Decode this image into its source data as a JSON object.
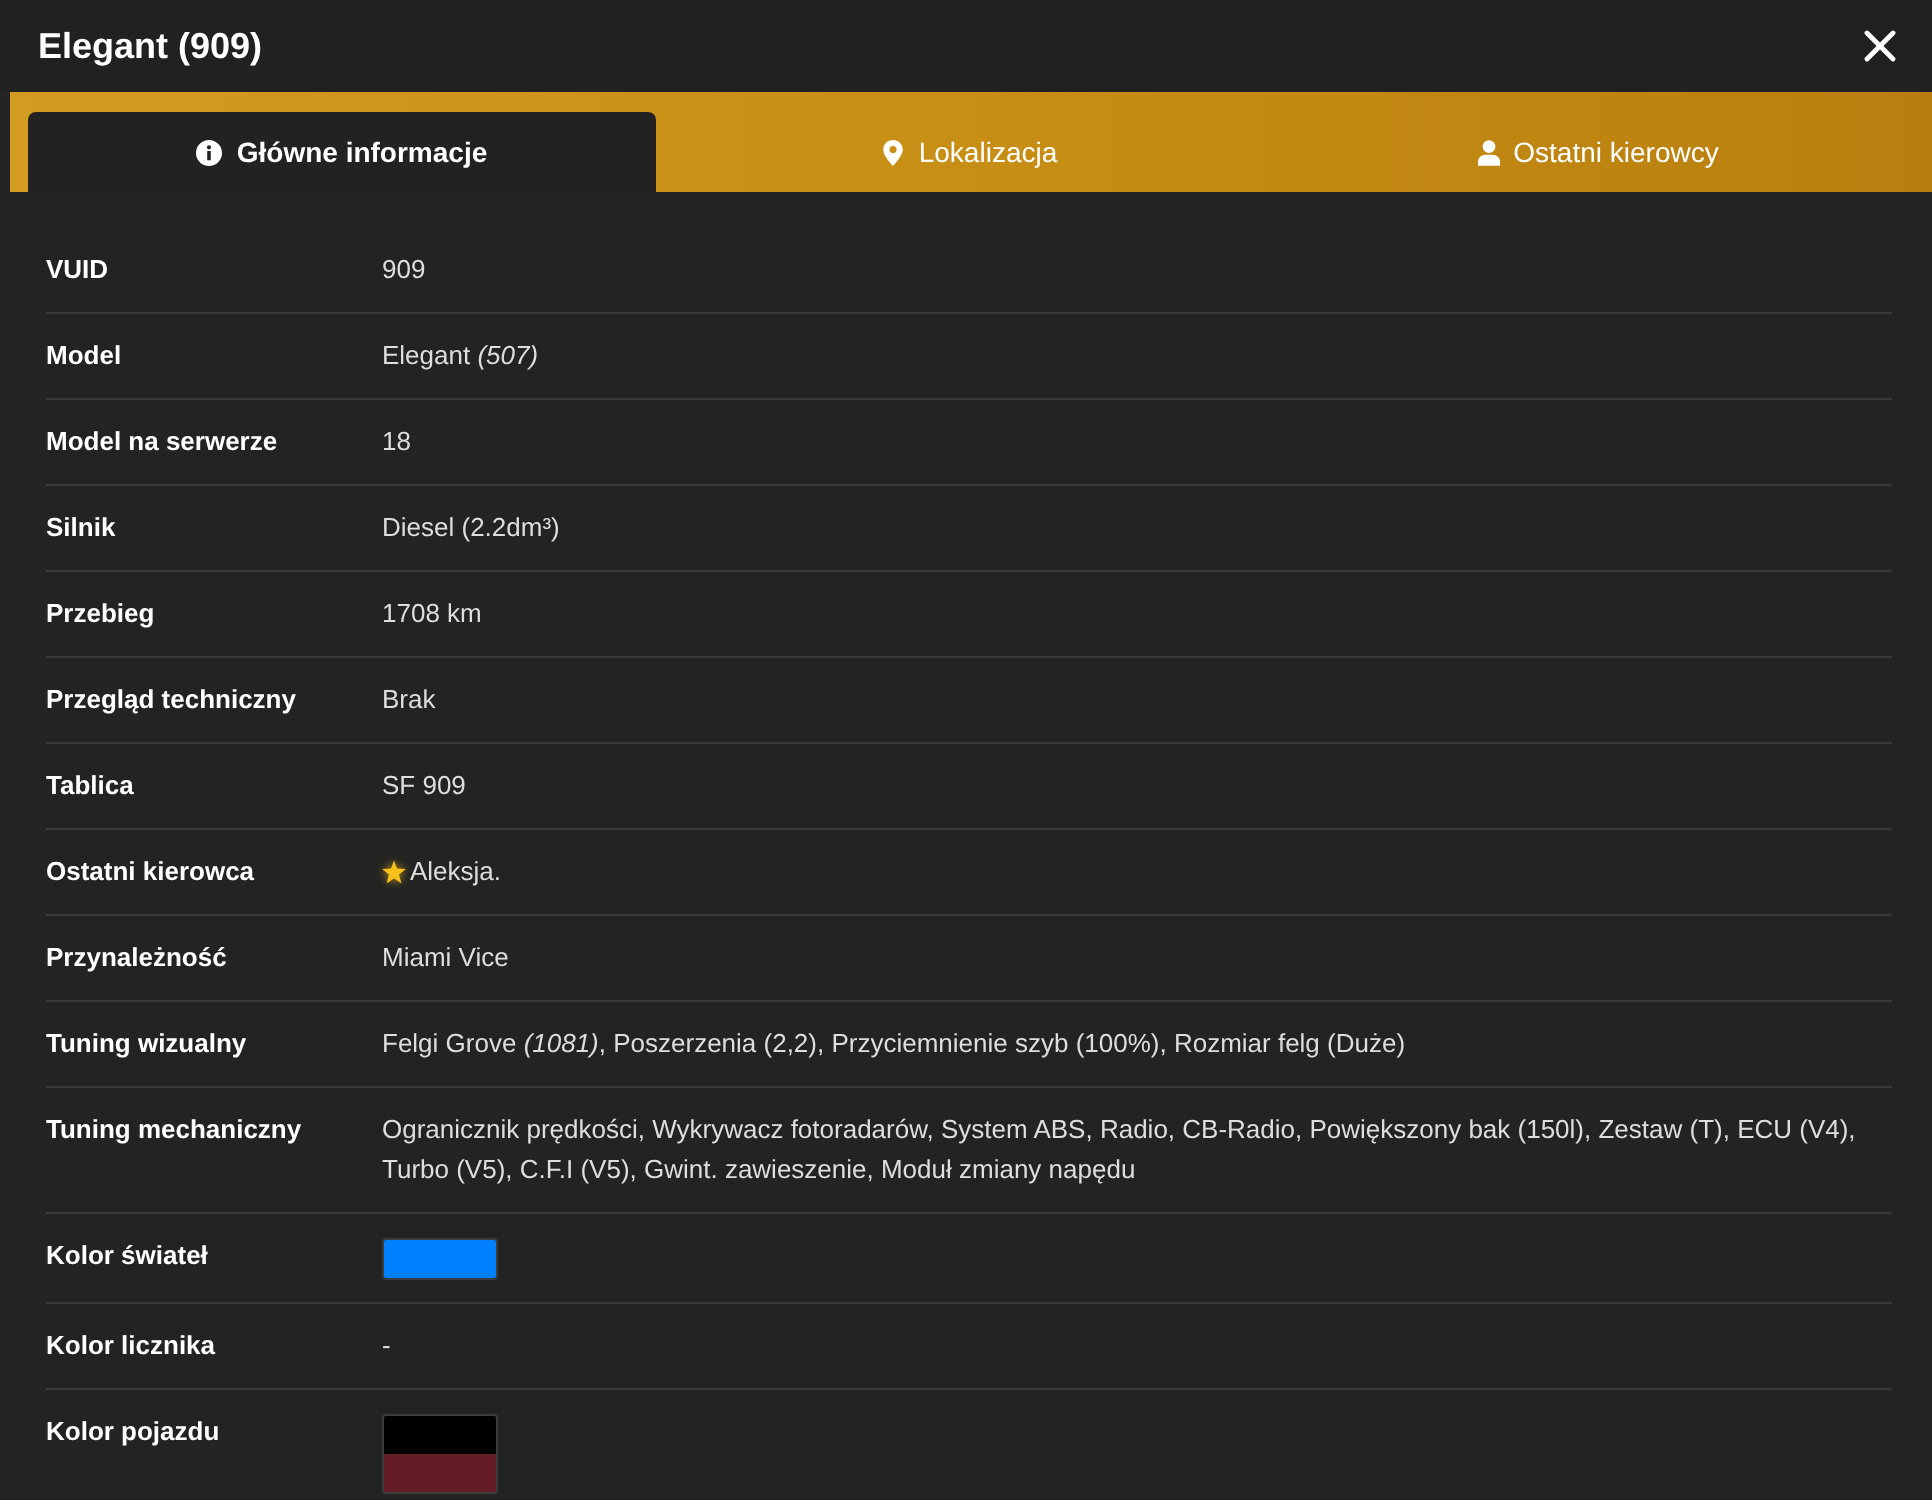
{
  "window": {
    "title": "Elegant (909)"
  },
  "tabs": [
    {
      "label": "Główne informacje",
      "selected": true
    },
    {
      "label": "Lokalizacja",
      "selected": false
    },
    {
      "label": "Ostatni kierowcy",
      "selected": false
    }
  ],
  "rows": [
    {
      "label": "VUID",
      "kind": "text",
      "value": "909"
    },
    {
      "label": "Model",
      "kind": "text",
      "value": "Elegant *(507)*"
    },
    {
      "label": "Model na serwerze",
      "kind": "text",
      "value": "18"
    },
    {
      "label": "Silnik",
      "kind": "text",
      "value": "Diesel (2.2dm³)"
    },
    {
      "label": "Przebieg",
      "kind": "text",
      "value": "1708 km"
    },
    {
      "label": "Przegląd techniczny",
      "kind": "text",
      "value": "Brak"
    },
    {
      "label": "Tablica",
      "kind": "text",
      "value": "SF 909"
    },
    {
      "label": "Ostatni kierowca",
      "kind": "text",
      "value": "Aleksja.",
      "starred": true
    },
    {
      "label": "Przynależność",
      "kind": "text",
      "value": "Miami Vice"
    },
    {
      "label": "Tuning wizualny",
      "kind": "text",
      "value": "Felgi Grove *(1081)*, Poszerzenia (2,2), Przyciemnienie szyb (100%), Rozmiar felg (Duże)"
    },
    {
      "label": "Tuning mechaniczny",
      "kind": "text",
      "value": "Ogranicznik prędkości, Wykrywacz fotoradarów, System ABS, Radio, CB-Radio, Powiększony bak (150l), Zestaw (T), ECU (V4), Turbo (V5), C.F.I (V5), Gwint. zawieszenie, Moduł zmiany napędu"
    },
    {
      "label": "Kolor świateł",
      "kind": "swatch",
      "colors": [
        {
          "color": "#0080ff"
        }
      ]
    },
    {
      "label": "Kolor licznika",
      "kind": "text",
      "value": "-"
    },
    {
      "label": "Kolor pojazdu",
      "kind": "swatch",
      "colors": [
        {
          "color": "#000000"
        },
        {
          "color": "#641c24"
        }
      ]
    }
  ]
}
